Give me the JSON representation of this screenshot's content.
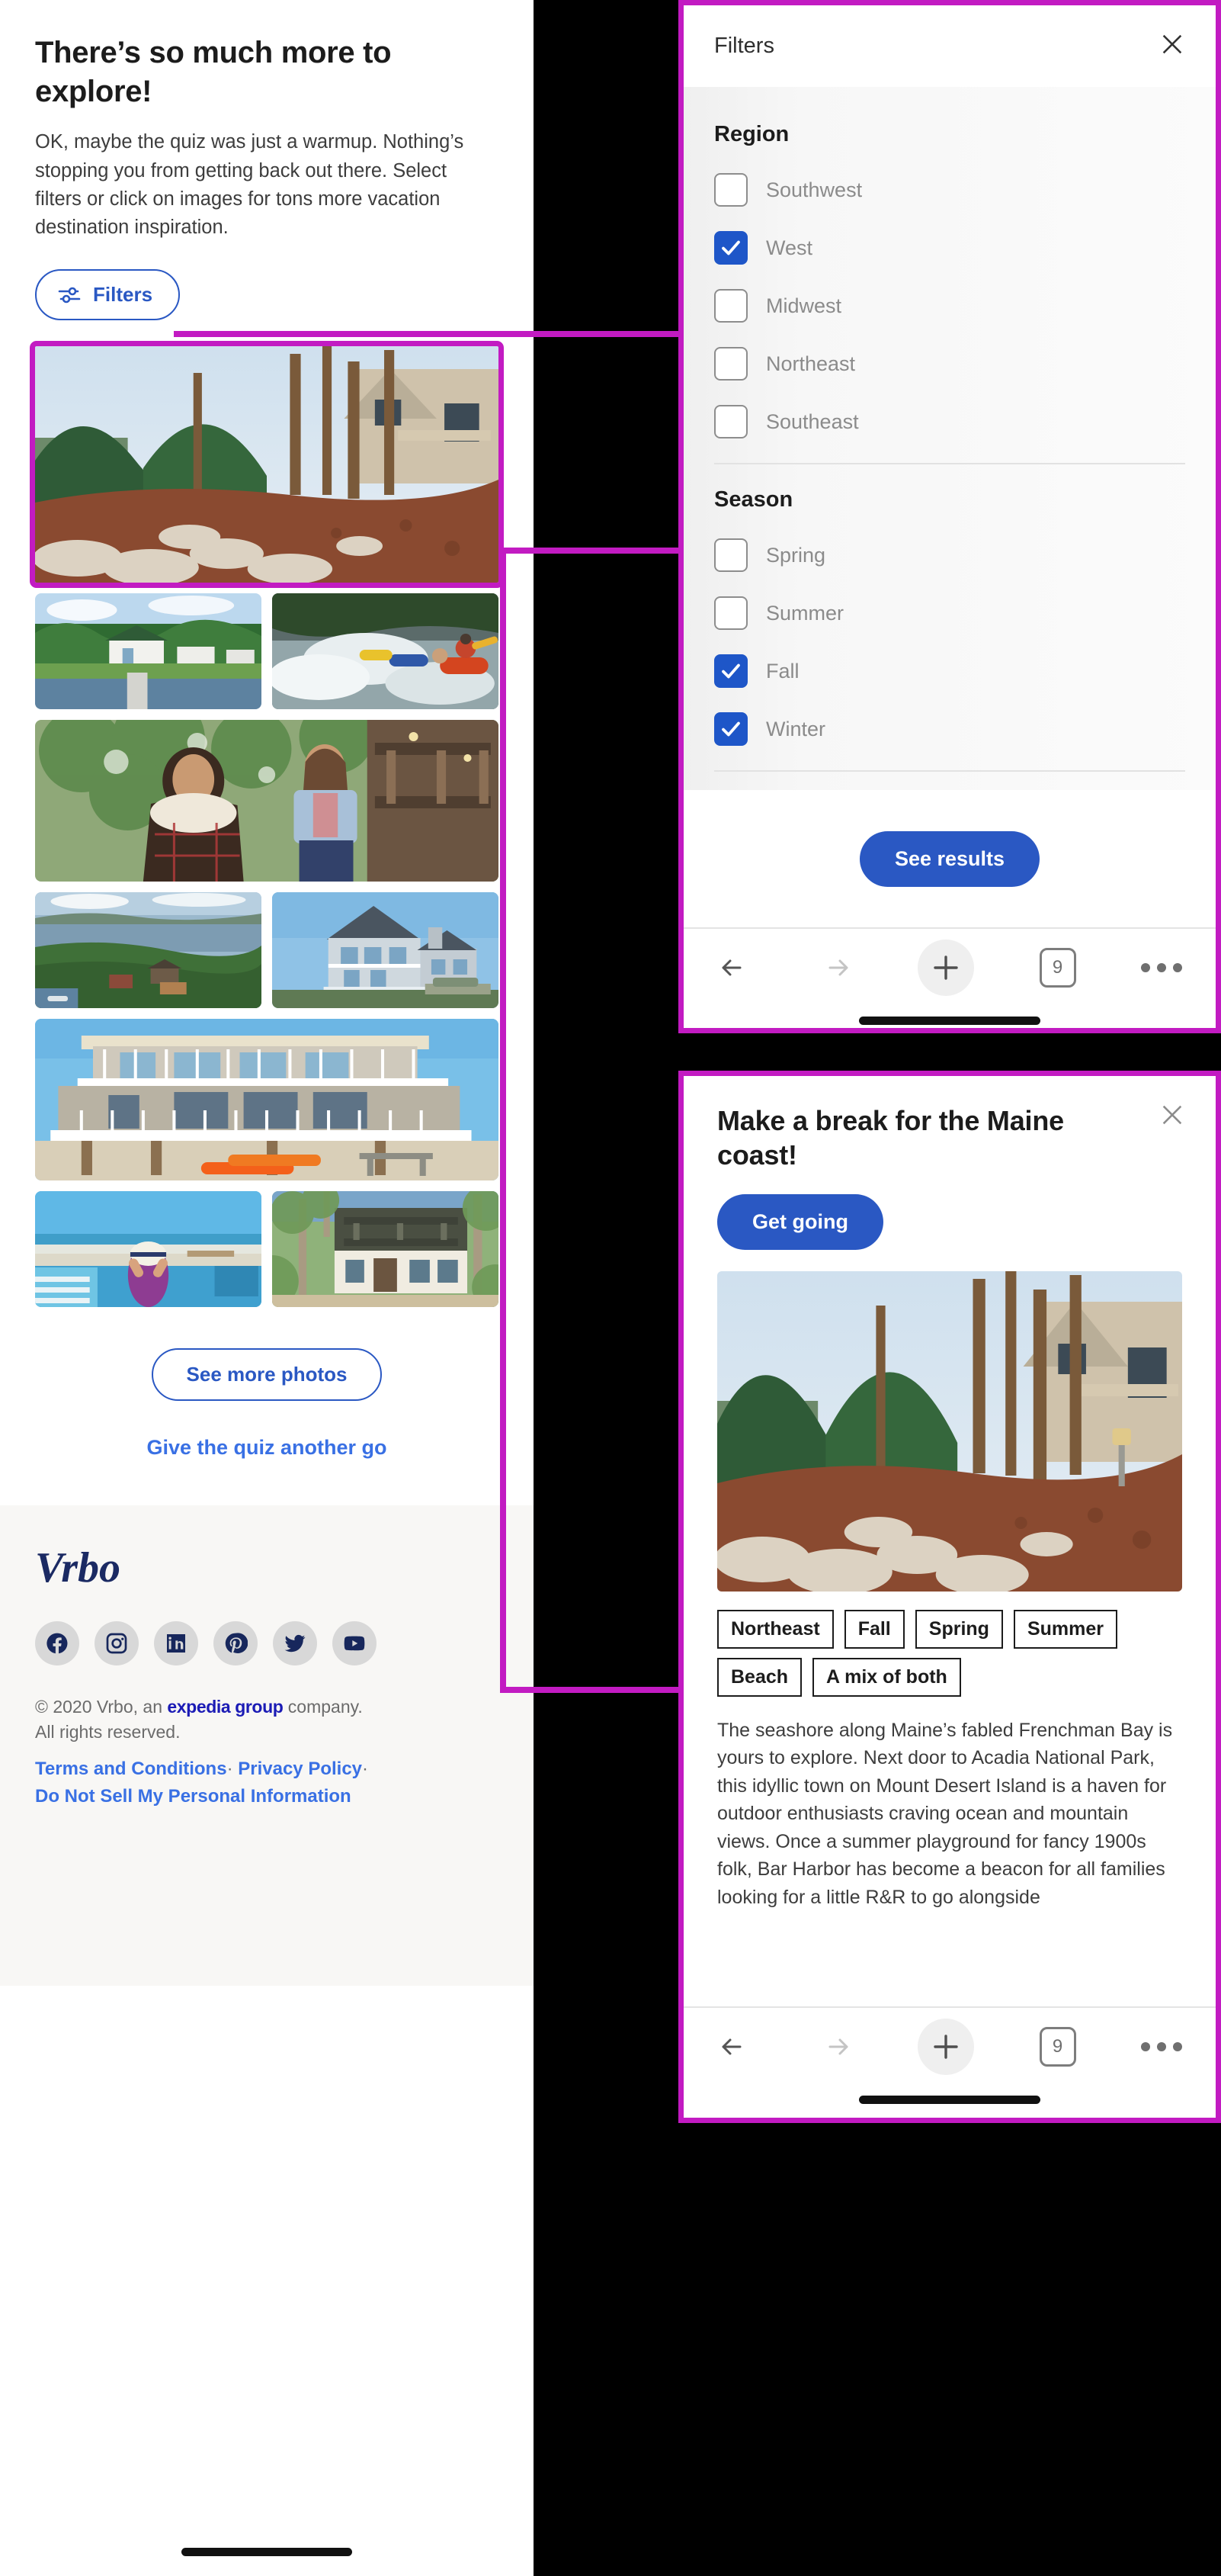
{
  "left": {
    "title": "There’s so much more to explore!",
    "subtitle": "OK, maybe the quiz was just a warmup. Nothing’s stopping you from getting back out there. Select filters or click on images for tons more vacation destination inspiration.",
    "filters_button": "Filters",
    "see_more_button": "See more photos",
    "quiz_again_link": "Give the quiz another go",
    "gallery": [
      {
        "name": "maine-coast-cabin-on-rocks",
        "alt": "Cabin among pine trees on rocky Maine coastline",
        "highlighted": true
      },
      {
        "name": "lakefront-house-with-dock",
        "alt": "Lakefront house with long dock and green lawn",
        "highlighted": false
      },
      {
        "name": "whitewater-rafting",
        "alt": "People whitewater rafting through rapids",
        "highlighted": false
      },
      {
        "name": "two-girls-outdoors",
        "alt": "Two girls outdoors looking up near a cabin",
        "highlighted": false
      },
      {
        "name": "aerial-lake-island-homes",
        "alt": "Aerial view of wooded lake shore with homes",
        "highlighted": false
      },
      {
        "name": "gray-shingle-beach-house",
        "alt": "Gray shingled beach house with deck",
        "highlighted": false
      },
      {
        "name": "white-beach-house-on-stilts",
        "alt": "Large white beach house on stilts with kayaks",
        "highlighted": false
      },
      {
        "name": "woman-at-beachfront-pool",
        "alt": "Woman in sun hat at a beachfront pool",
        "highlighted": false
      },
      {
        "name": "coastal-home-in-trees",
        "alt": "Two story coastal home nestled among trees",
        "highlighted": false
      }
    ],
    "footer": {
      "logo": "Vrbo",
      "socials": [
        {
          "name": "facebook-icon",
          "label": "Facebook"
        },
        {
          "name": "instagram-icon",
          "label": "Instagram"
        },
        {
          "name": "linkedin-icon",
          "label": "LinkedIn"
        },
        {
          "name": "pinterest-icon",
          "label": "Pinterest"
        },
        {
          "name": "twitter-icon",
          "label": "Twitter"
        },
        {
          "name": "youtube-icon",
          "label": "YouTube"
        }
      ],
      "copyright_pre": "© 2020 Vrbo, an ",
      "copyright_brand": "expedia group",
      "copyright_post": " company.",
      "rights": "All rights reserved.",
      "links": [
        {
          "label": "Terms and Conditions"
        },
        {
          "label": "Privacy Policy"
        },
        {
          "label": "Do Not Sell My Personal Information"
        }
      ],
      "link_separator": "·"
    }
  },
  "filters_panel": {
    "title": "Filters",
    "close_icon": "close-icon",
    "sections": [
      {
        "heading": "Region",
        "options": [
          {
            "label": "Southwest",
            "checked": false
          },
          {
            "label": "West",
            "checked": true
          },
          {
            "label": "Midwest",
            "checked": false
          },
          {
            "label": "Northeast",
            "checked": false
          },
          {
            "label": "Southeast",
            "checked": false
          }
        ]
      },
      {
        "heading": "Season",
        "options": [
          {
            "label": "Spring",
            "checked": false
          },
          {
            "label": "Summer",
            "checked": false
          },
          {
            "label": "Fall",
            "checked": true
          },
          {
            "label": "Winter",
            "checked": true
          }
        ]
      }
    ],
    "see_results_button": "See results"
  },
  "detail_panel": {
    "title": "Make a break for the Maine coast!",
    "cta_button": "Get going",
    "close_icon": "close-icon",
    "image": {
      "name": "maine-coast-cabin-on-rocks",
      "alt": "Cabin among pine trees on rocky Maine coastline"
    },
    "tags": [
      [
        "Northeast",
        "Fall",
        "Spring",
        "Summer"
      ],
      [
        "Beach",
        "A mix of both"
      ]
    ],
    "description": "The seashore along Maine’s fabled Frenchman Bay is yours to explore. Next door to Acadia National Park, this idyllic town on Mount Desert Island is a haven for outdoor enthusiasts craving ocean and mountain views. Once a summer playground for fancy 1900s folk, Bar Harbor has become a beacon for all families looking for a little R&R to go alongside"
  },
  "browser_chrome": {
    "back_icon": "arrow-left-icon",
    "forward_icon": "arrow-right-icon",
    "new_tab_icon": "plus-icon",
    "tab_count": "9",
    "more_icon": "ellipsis-icon"
  },
  "colors": {
    "accent_blue": "#2a58c3",
    "link_blue": "#3970e4",
    "checkbox_blue": "#1e56c8",
    "highlight_magenta": "#c21bc2",
    "footer_bg": "#f8f7f5"
  }
}
